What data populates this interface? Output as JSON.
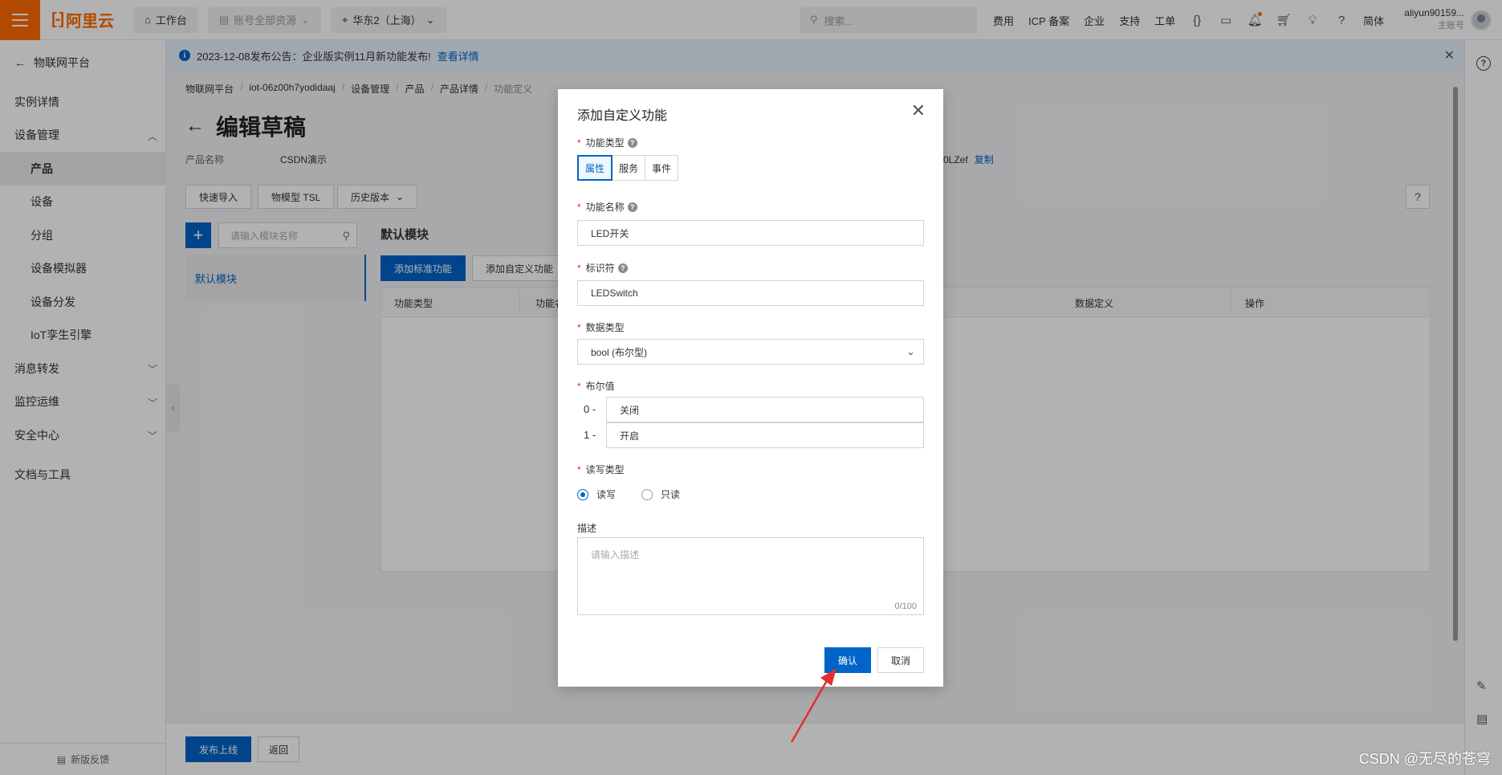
{
  "topbar": {
    "brand": "阿里云",
    "workbench": "工作台",
    "resources": "账号全部资源",
    "region": "华东2（上海）",
    "search_placeholder": "搜索...",
    "links": [
      "费用",
      "ICP 备案",
      "企业",
      "支持",
      "工单"
    ],
    "lang": "简体",
    "user_name": "aliyun90159...",
    "user_role": "主账号",
    "brand_color": "#ff6a00"
  },
  "sidebar": {
    "back_label": "物联网平台",
    "items": [
      {
        "label": "实例详情"
      },
      {
        "label": "设备管理"
      },
      {
        "label": "产品"
      },
      {
        "label": "设备"
      },
      {
        "label": "分组"
      },
      {
        "label": "设备模拟器"
      },
      {
        "label": "设备分发"
      },
      {
        "label": "IoT孪生引擎"
      },
      {
        "label": "消息转发"
      },
      {
        "label": "监控运维"
      },
      {
        "label": "安全中心"
      },
      {
        "label": "文档与工具"
      }
    ],
    "feedback": "新版反馈"
  },
  "notice": {
    "text": "2023-12-08发布公告：企业版实例11月新功能发布!",
    "link": "查看详情"
  },
  "breadcrumb": [
    "物联网平台",
    "iot-06z00h7yodidaaj",
    "设备管理",
    "产品",
    "产品详情",
    "功能定义"
  ],
  "page": {
    "title": "编辑草稿",
    "product_name_label": "产品名称",
    "product_name": "CSDN演示",
    "product_key_tail": "0LZef",
    "copy": "复制",
    "tools": [
      "快速导入",
      "物模型 TSL",
      "历史版本"
    ],
    "help": "?"
  },
  "module": {
    "search_placeholder": "请输入模块名称",
    "item": "默认模块",
    "title": "默认模块",
    "add_standard": "添加标准功能",
    "add_custom": "添加自定义功能"
  },
  "table": {
    "headers": [
      "功能类型",
      "功能名",
      "数据定义",
      "操作"
    ]
  },
  "bottom": {
    "publish": "发布上线",
    "back": "返回"
  },
  "modal": {
    "title": "添加自定义功能",
    "func_type_label": "功能类型",
    "func_types": [
      "属性",
      "服务",
      "事件"
    ],
    "func_name_label": "功能名称",
    "func_name": "LED开关",
    "identifier_label": "标识符",
    "identifier": "LEDSwitch",
    "data_type_label": "数据类型",
    "data_type": "bool (布尔型)",
    "bool_label": "布尔值",
    "bool_values": [
      {
        "key": "0 -",
        "value": "关闭"
      },
      {
        "key": "1 -",
        "value": "开启"
      }
    ],
    "rw_label": "读写类型",
    "rw_options": [
      "读写",
      "只读"
    ],
    "desc_label": "描述",
    "desc_placeholder": "请输入描述",
    "desc_count": "0/100",
    "ok": "确认",
    "cancel": "取消",
    "accent": "#0064c8"
  },
  "watermark": "CSDN @无尽的苍穹"
}
